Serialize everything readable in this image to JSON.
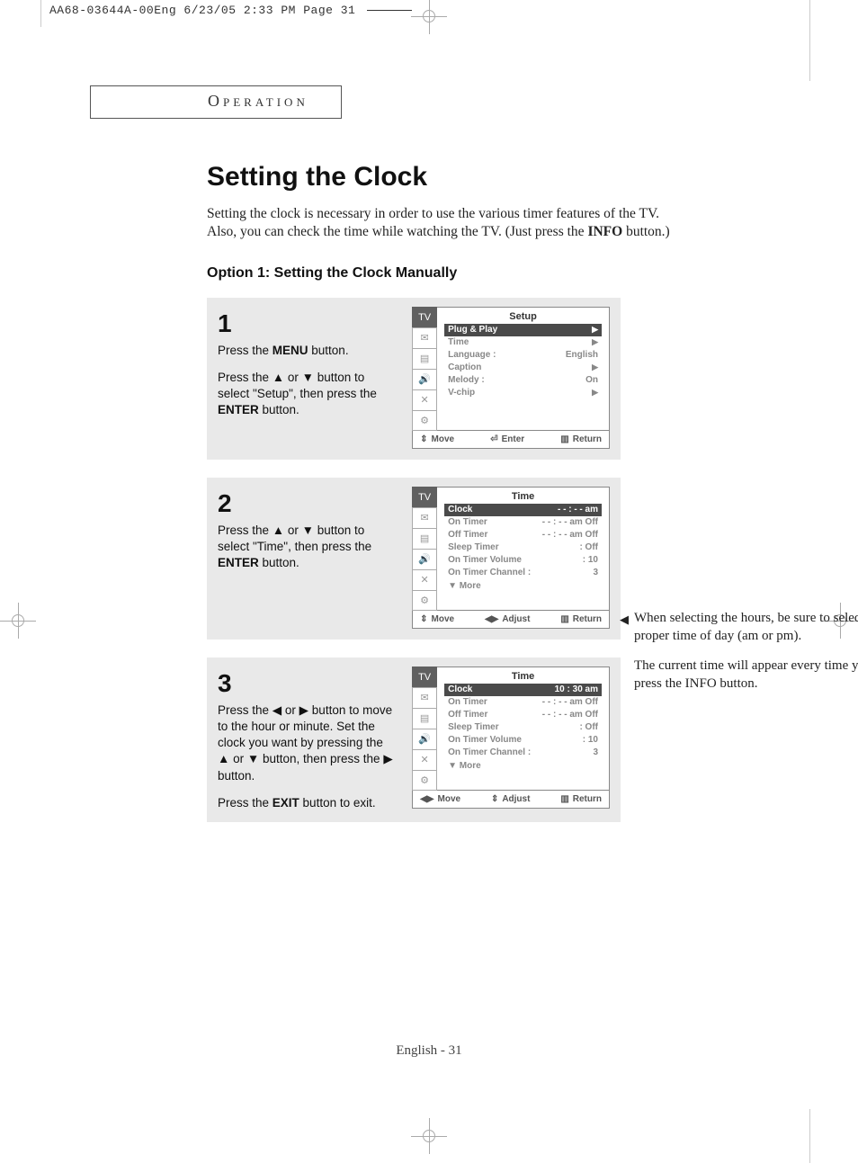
{
  "print_header": "AA68-03644A-00Eng  6/23/05  2:33 PM  Page 31",
  "section_label": "Operation",
  "title": "Setting the Clock",
  "intro_line1": "Setting the clock is necessary in order to use the various timer features of the TV.",
  "intro_line2_a": "Also, you can check the time while watching the TV. (Just press the ",
  "intro_line2_b": "INFO",
  "intro_line2_c": " button.)",
  "option_heading": "Option 1: Setting the Clock Manually",
  "steps": {
    "s1": {
      "num": "1",
      "p1a": "Press the ",
      "p1b": "MENU",
      "p1c": " button.",
      "p2a": "Press the ▲ or ▼ button to select \"Setup\", then press the ",
      "p2b": "ENTER",
      "p2c": " button.",
      "tv_title": "Setup",
      "rows": [
        {
          "l": "Plug & Play",
          "r": "▶",
          "sel": true
        },
        {
          "l": "Time",
          "r": "▶"
        },
        {
          "l": "Language :",
          "r": "English"
        },
        {
          "l": "Caption",
          "r": "▶"
        },
        {
          "l": "Melody    :",
          "r": "On"
        },
        {
          "l": "V-chip",
          "r": "▶"
        }
      ],
      "footer": {
        "a": "Move",
        "ag": "⇕",
        "b": "Enter",
        "bg": "⏎",
        "c": "Return",
        "cg": "▥"
      }
    },
    "s2": {
      "num": "2",
      "p1a": "Press the ▲ or ▼ button to select \"Time\", then press the ",
      "p1b": "ENTER",
      "p1c": " button.",
      "tv_title": "Time",
      "rows": [
        {
          "l": "Clock",
          "r": "- - : - -  am",
          "sel": true
        },
        {
          "l": "On Timer",
          "r": "- - : - -  am Off"
        },
        {
          "l": "Off Timer",
          "r": "- - : - -  am Off"
        },
        {
          "l": "Sleep Timer",
          "r": ": Off"
        },
        {
          "l": "On Timer Volume",
          "r": ": 10"
        },
        {
          "l": "On Timer Channel :",
          "r": "3"
        }
      ],
      "more": "▼ More",
      "footer": {
        "a": "Move",
        "ag": "⇕",
        "b": "Adjust",
        "bg": "◀▶",
        "c": "Return",
        "cg": "▥"
      }
    },
    "s3": {
      "num": "3",
      "p1": "Press the ◀ or ▶ button to move to the hour or minute. Set the clock you want by pressing the ▲ or ▼ button, then press the ▶ button.",
      "p2a": "Press the ",
      "p2b": "EXIT",
      "p2c": " button to exit.",
      "tv_title": "Time",
      "rows": [
        {
          "l": "Clock",
          "r": "10 : 30  am",
          "sel": true,
          "clocksel": true
        },
        {
          "l": "On Timer",
          "r": "- - : - -  am Off"
        },
        {
          "l": "Off Timer",
          "r": "- - : - -  am Off"
        },
        {
          "l": "Sleep Timer",
          "r": ": Off"
        },
        {
          "l": "On Timer Volume",
          "r": ": 10"
        },
        {
          "l": "On Timer Channel :",
          "r": "3"
        }
      ],
      "more": "▼ More",
      "footer": {
        "a": "Move",
        "ag": "◀▶",
        "b": "Adjust",
        "bg": "⇕",
        "c": "Return",
        "cg": "▥"
      }
    }
  },
  "tabs": [
    "TV",
    "✉",
    "▤",
    "🔊",
    "✕",
    "⚙"
  ],
  "note": {
    "p1": "When selecting the hours, be sure to select the proper time of day (am or pm).",
    "p2": "The current time will appear every time you press the INFO button."
  },
  "page_footer": "English - 31"
}
